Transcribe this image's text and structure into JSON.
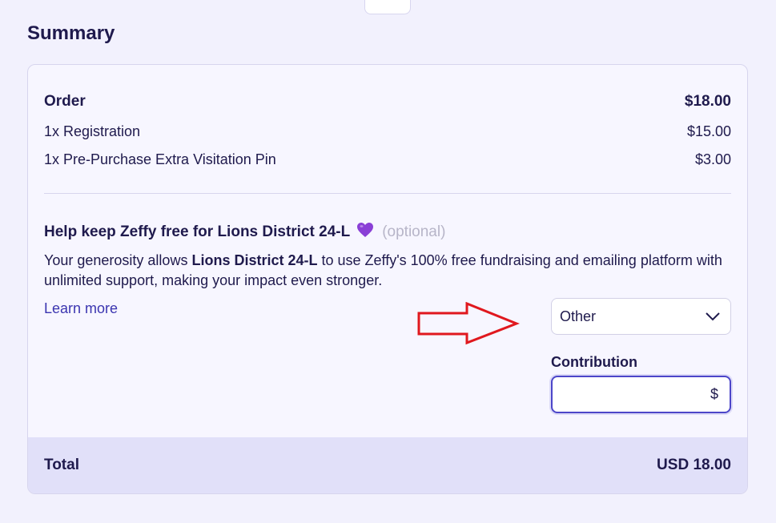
{
  "summary": {
    "title": "Summary"
  },
  "order": {
    "label": "Order",
    "total": "$18.00",
    "items": [
      {
        "label": "1x Registration",
        "price": "$15.00"
      },
      {
        "label": "1x Pre-Purchase Extra Visitation Pin",
        "price": "$3.00"
      }
    ]
  },
  "help": {
    "title": "Help keep Zeffy free for Lions District 24-L",
    "optional": "(optional)",
    "desc_prefix": "Your generosity allows ",
    "desc_org": "Lions District 24-L",
    "desc_suffix": " to use Zeffy's 100% free fundraising and emailing platform with unlimited support, making your impact even stronger.",
    "learn_more": "Learn more"
  },
  "contribution": {
    "select_value": "Other",
    "label": "Contribution",
    "currency_symbol": "$"
  },
  "total": {
    "label": "Total",
    "value": "USD 18.00"
  },
  "icons": {
    "close": "close-icon",
    "heart": "purple-heart-icon",
    "chevron": "chevron-down-icon",
    "arrow": "red-arrow-annotation"
  },
  "colors": {
    "accent": "#4c46c9",
    "text": "#1f1a4d",
    "arrow": "#e0181e",
    "heart": "#8a3fd6"
  }
}
